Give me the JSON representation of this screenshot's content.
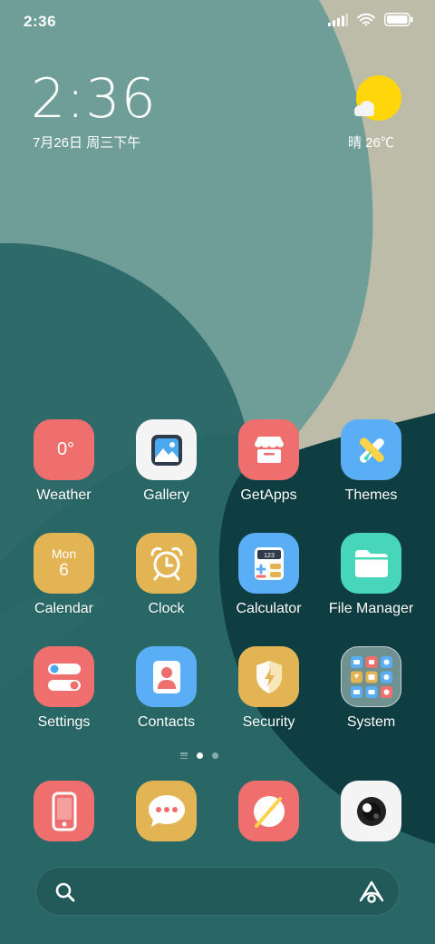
{
  "status_bar": {
    "time": "2:36",
    "icons": [
      "signal-icon",
      "wifi-icon",
      "battery-icon"
    ]
  },
  "clock_widget": {
    "time": "2:36",
    "date": "7月26日 周三下午",
    "weather_icon": "sun-cloud-icon",
    "weather": "晴 26℃"
  },
  "apps": [
    {
      "label": "Weather",
      "icon": "weather-icon",
      "icon_text": "0°",
      "color": "#ef6e6e"
    },
    {
      "label": "Gallery",
      "icon": "gallery-icon",
      "color": "#f4f4f4"
    },
    {
      "label": "GetApps",
      "icon": "store-icon",
      "color": "#ef6e6e"
    },
    {
      "label": "Themes",
      "icon": "themes-icon",
      "color": "#5aaef5"
    },
    {
      "label": "Calendar",
      "icon": "calendar-icon",
      "icon_day": "Mon",
      "icon_date": "6",
      "color": "#e3b454"
    },
    {
      "label": "Clock",
      "icon": "alarm-clock-icon",
      "color": "#e3b454"
    },
    {
      "label": "Calculator",
      "icon": "calculator-icon",
      "icon_text": "123",
      "color": "#5aaef5"
    },
    {
      "label": "File Manager",
      "icon": "folder-icon",
      "color": "#48d6bb"
    },
    {
      "label": "Settings",
      "icon": "settings-toggle-icon",
      "color": "#ef6e6e"
    },
    {
      "label": "Contacts",
      "icon": "contact-icon",
      "color": "#5aaef5"
    },
    {
      "label": "Security",
      "icon": "shield-icon",
      "color": "#e3b454"
    },
    {
      "label": "System",
      "icon": "folder-grid-icon",
      "color": "#6f9291"
    }
  ],
  "page_indicator": {
    "pages": 2,
    "active": 1
  },
  "dock": [
    {
      "icon": "phone-icon",
      "color": "#ef6e6e"
    },
    {
      "icon": "messages-icon",
      "color": "#e3b454"
    },
    {
      "icon": "browser-icon",
      "color": "#ef6e6e"
    },
    {
      "icon": "camera-icon",
      "color": "#f4f4f4"
    }
  ],
  "search": {
    "placeholder": "",
    "left_icon": "search-icon",
    "right_icon": "assistant-icon"
  },
  "colors": {
    "accent_red": "#ef6e6e",
    "accent_yellow": "#e3b454",
    "accent_blue": "#5aaef5",
    "accent_teal": "#48d6bb",
    "sun": "#ffd60a"
  }
}
